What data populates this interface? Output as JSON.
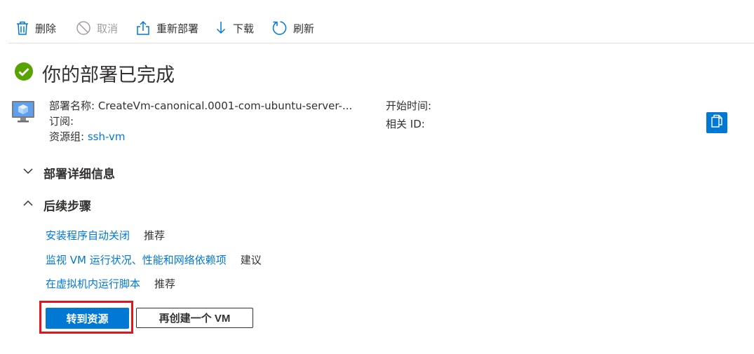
{
  "toolbar": {
    "delete_label": "删除",
    "cancel_label": "取消",
    "redeploy_label": "重新部署",
    "download_label": "下载",
    "refresh_label": "刷新"
  },
  "deployment": {
    "title": "你的部署已完成",
    "name_label": "部署名称:",
    "name_value": "CreateVm-canonical.0001-com-ubuntu-server-...",
    "subscription_label": "订阅:",
    "resource_group_label": "资源组:",
    "resource_group_value": "ssh-vm",
    "start_time_label": "开始时间:",
    "correlation_id_label": "相关 ID:"
  },
  "sections": {
    "details_title": "部署详细信息",
    "next_steps_title": "后续步骤"
  },
  "next_steps": [
    {
      "link": "安装程序自动关闭",
      "tag": "推荐"
    },
    {
      "link": "监视 VM 运行状况、性能和网络依赖项",
      "tag": "建议"
    },
    {
      "link": "在虚拟机内运行脚本",
      "tag": "推荐"
    }
  ],
  "buttons": {
    "go_to_resource": "转到资源",
    "create_another": "再创建一个 VM"
  },
  "colors": {
    "accent": "#0078d4",
    "success": "#57a300",
    "highlight": "#e8141d"
  }
}
